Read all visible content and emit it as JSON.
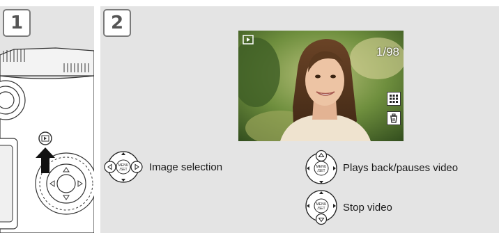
{
  "steps": [
    {
      "number": "1"
    },
    {
      "number": "2"
    }
  ],
  "screen": {
    "frame_counter": "1/98",
    "icons": [
      "playback-mode-icon",
      "thumbnail-grid-icon",
      "trash-icon"
    ]
  },
  "instructions": [
    {
      "text": "Image selection",
      "control": "dial-left-right"
    },
    {
      "text": "Plays back/pauses video",
      "control": "dial-up"
    },
    {
      "text": "Stop video",
      "control": "dial-down"
    }
  ],
  "dial_center_label": "MENU /SET",
  "colors": {
    "panel": "#e4e4e4",
    "badge_border": "#7a7a7a",
    "arrow": "#111111"
  }
}
